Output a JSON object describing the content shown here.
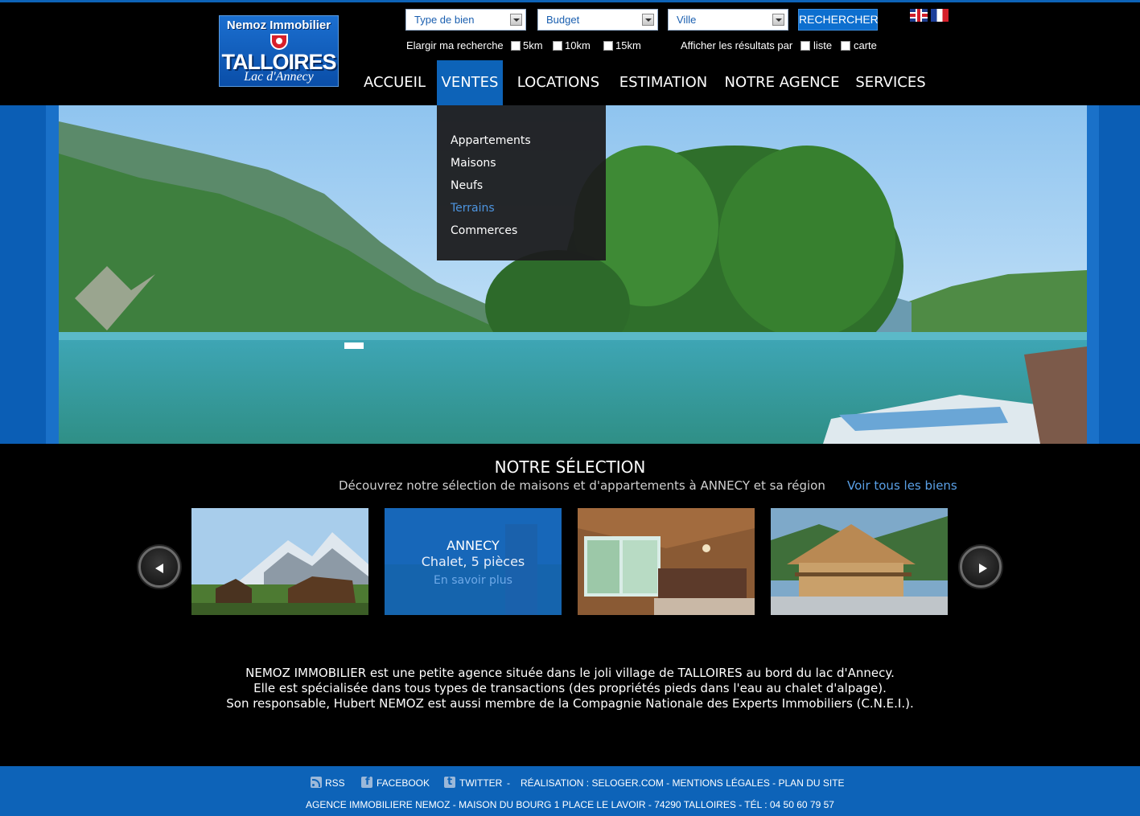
{
  "logo": {
    "line1": "Nemoz Immobilier",
    "line2": "TALLOIRES",
    "line3": "Lac d'Annecy"
  },
  "search": {
    "type_label": "Type de bien",
    "budget_label": "Budget",
    "city_label": "Ville",
    "submit_label": "RECHERCHER",
    "widen_label": "Elargir ma recherche",
    "radius_options": [
      "5km",
      "10km",
      "15km"
    ],
    "display_label": "Afficher les résultats par",
    "display_options": [
      "liste",
      "carte"
    ]
  },
  "languages": [
    "english-flag-icon",
    "french-flag-icon"
  ],
  "nav": {
    "items": [
      "ACCUEIL",
      "VENTES",
      "LOCATIONS",
      "ESTIMATION",
      "NOTRE AGENCE",
      "SERVICES"
    ],
    "active_index": 1
  },
  "dropdown": {
    "items": [
      "Appartements",
      "Maisons",
      "Neufs",
      "Terrains",
      "Commerces"
    ],
    "highlighted_index": 3
  },
  "selection": {
    "title": "NOTRE SÉLECTION",
    "subtitle": "Découvrez notre sélection de maisons et d'appartements à ANNECY et sa région",
    "see_all": "Voir tous les biens",
    "featured": {
      "city": "ANNECY",
      "type": "Chalet, 5 pièces",
      "more": "En savoir plus"
    }
  },
  "about": {
    "lines": [
      "NEMOZ IMMOBILIER est une petite agence située dans le joli village de TALLOIRES au bord du lac d'Annecy.",
      "Elle est spécialisée dans tous types de transactions (des propriétés pieds dans l'eau au chalet d'alpage).",
      "Son responsable, Hubert NEMOZ est aussi membre de la Compagnie Nationale des Experts Immobiliers (C.N.E.I.)."
    ]
  },
  "footer": {
    "rss": "RSS",
    "facebook": "FACEBOOK",
    "twitter": "TWITTER",
    "sep": "-",
    "credits": "RÉALISATION : SELOGER.COM - MENTIONS LÉGALES - PLAN DU SITE",
    "address": "AGENCE IMMOBILIERE NEMOZ - MAISON DU BOURG 1 PLACE LE LAVOIR - 74290 TALLOIRES - TÉL : 04 50 60 79 57"
  },
  "colors": {
    "brand_blue": "#0d63b8",
    "link_blue": "#5aa0e6",
    "background": "#000000"
  }
}
